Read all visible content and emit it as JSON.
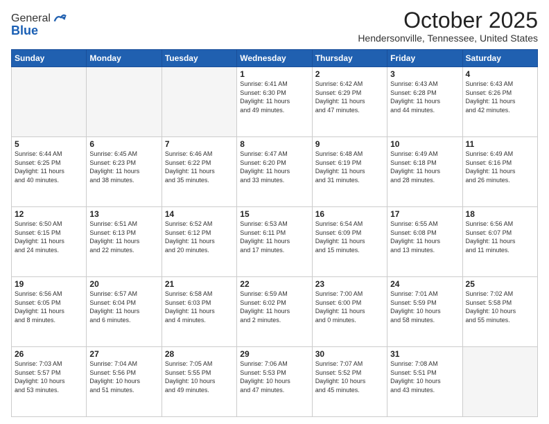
{
  "header": {
    "logo_general": "General",
    "logo_blue": "Blue",
    "month": "October 2025",
    "location": "Hendersonville, Tennessee, United States"
  },
  "days_of_week": [
    "Sunday",
    "Monday",
    "Tuesday",
    "Wednesday",
    "Thursday",
    "Friday",
    "Saturday"
  ],
  "weeks": [
    [
      {
        "day": "",
        "info": ""
      },
      {
        "day": "",
        "info": ""
      },
      {
        "day": "",
        "info": ""
      },
      {
        "day": "1",
        "info": "Sunrise: 6:41 AM\nSunset: 6:30 PM\nDaylight: 11 hours\nand 49 minutes."
      },
      {
        "day": "2",
        "info": "Sunrise: 6:42 AM\nSunset: 6:29 PM\nDaylight: 11 hours\nand 47 minutes."
      },
      {
        "day": "3",
        "info": "Sunrise: 6:43 AM\nSunset: 6:28 PM\nDaylight: 11 hours\nand 44 minutes."
      },
      {
        "day": "4",
        "info": "Sunrise: 6:43 AM\nSunset: 6:26 PM\nDaylight: 11 hours\nand 42 minutes."
      }
    ],
    [
      {
        "day": "5",
        "info": "Sunrise: 6:44 AM\nSunset: 6:25 PM\nDaylight: 11 hours\nand 40 minutes."
      },
      {
        "day": "6",
        "info": "Sunrise: 6:45 AM\nSunset: 6:23 PM\nDaylight: 11 hours\nand 38 minutes."
      },
      {
        "day": "7",
        "info": "Sunrise: 6:46 AM\nSunset: 6:22 PM\nDaylight: 11 hours\nand 35 minutes."
      },
      {
        "day": "8",
        "info": "Sunrise: 6:47 AM\nSunset: 6:20 PM\nDaylight: 11 hours\nand 33 minutes."
      },
      {
        "day": "9",
        "info": "Sunrise: 6:48 AM\nSunset: 6:19 PM\nDaylight: 11 hours\nand 31 minutes."
      },
      {
        "day": "10",
        "info": "Sunrise: 6:49 AM\nSunset: 6:18 PM\nDaylight: 11 hours\nand 28 minutes."
      },
      {
        "day": "11",
        "info": "Sunrise: 6:49 AM\nSunset: 6:16 PM\nDaylight: 11 hours\nand 26 minutes."
      }
    ],
    [
      {
        "day": "12",
        "info": "Sunrise: 6:50 AM\nSunset: 6:15 PM\nDaylight: 11 hours\nand 24 minutes."
      },
      {
        "day": "13",
        "info": "Sunrise: 6:51 AM\nSunset: 6:13 PM\nDaylight: 11 hours\nand 22 minutes."
      },
      {
        "day": "14",
        "info": "Sunrise: 6:52 AM\nSunset: 6:12 PM\nDaylight: 11 hours\nand 20 minutes."
      },
      {
        "day": "15",
        "info": "Sunrise: 6:53 AM\nSunset: 6:11 PM\nDaylight: 11 hours\nand 17 minutes."
      },
      {
        "day": "16",
        "info": "Sunrise: 6:54 AM\nSunset: 6:09 PM\nDaylight: 11 hours\nand 15 minutes."
      },
      {
        "day": "17",
        "info": "Sunrise: 6:55 AM\nSunset: 6:08 PM\nDaylight: 11 hours\nand 13 minutes."
      },
      {
        "day": "18",
        "info": "Sunrise: 6:56 AM\nSunset: 6:07 PM\nDaylight: 11 hours\nand 11 minutes."
      }
    ],
    [
      {
        "day": "19",
        "info": "Sunrise: 6:56 AM\nSunset: 6:05 PM\nDaylight: 11 hours\nand 8 minutes."
      },
      {
        "day": "20",
        "info": "Sunrise: 6:57 AM\nSunset: 6:04 PM\nDaylight: 11 hours\nand 6 minutes."
      },
      {
        "day": "21",
        "info": "Sunrise: 6:58 AM\nSunset: 6:03 PM\nDaylight: 11 hours\nand 4 minutes."
      },
      {
        "day": "22",
        "info": "Sunrise: 6:59 AM\nSunset: 6:02 PM\nDaylight: 11 hours\nand 2 minutes."
      },
      {
        "day": "23",
        "info": "Sunrise: 7:00 AM\nSunset: 6:00 PM\nDaylight: 11 hours\nand 0 minutes."
      },
      {
        "day": "24",
        "info": "Sunrise: 7:01 AM\nSunset: 5:59 PM\nDaylight: 10 hours\nand 58 minutes."
      },
      {
        "day": "25",
        "info": "Sunrise: 7:02 AM\nSunset: 5:58 PM\nDaylight: 10 hours\nand 55 minutes."
      }
    ],
    [
      {
        "day": "26",
        "info": "Sunrise: 7:03 AM\nSunset: 5:57 PM\nDaylight: 10 hours\nand 53 minutes."
      },
      {
        "day": "27",
        "info": "Sunrise: 7:04 AM\nSunset: 5:56 PM\nDaylight: 10 hours\nand 51 minutes."
      },
      {
        "day": "28",
        "info": "Sunrise: 7:05 AM\nSunset: 5:55 PM\nDaylight: 10 hours\nand 49 minutes."
      },
      {
        "day": "29",
        "info": "Sunrise: 7:06 AM\nSunset: 5:53 PM\nDaylight: 10 hours\nand 47 minutes."
      },
      {
        "day": "30",
        "info": "Sunrise: 7:07 AM\nSunset: 5:52 PM\nDaylight: 10 hours\nand 45 minutes."
      },
      {
        "day": "31",
        "info": "Sunrise: 7:08 AM\nSunset: 5:51 PM\nDaylight: 10 hours\nand 43 minutes."
      },
      {
        "day": "",
        "info": ""
      }
    ]
  ]
}
